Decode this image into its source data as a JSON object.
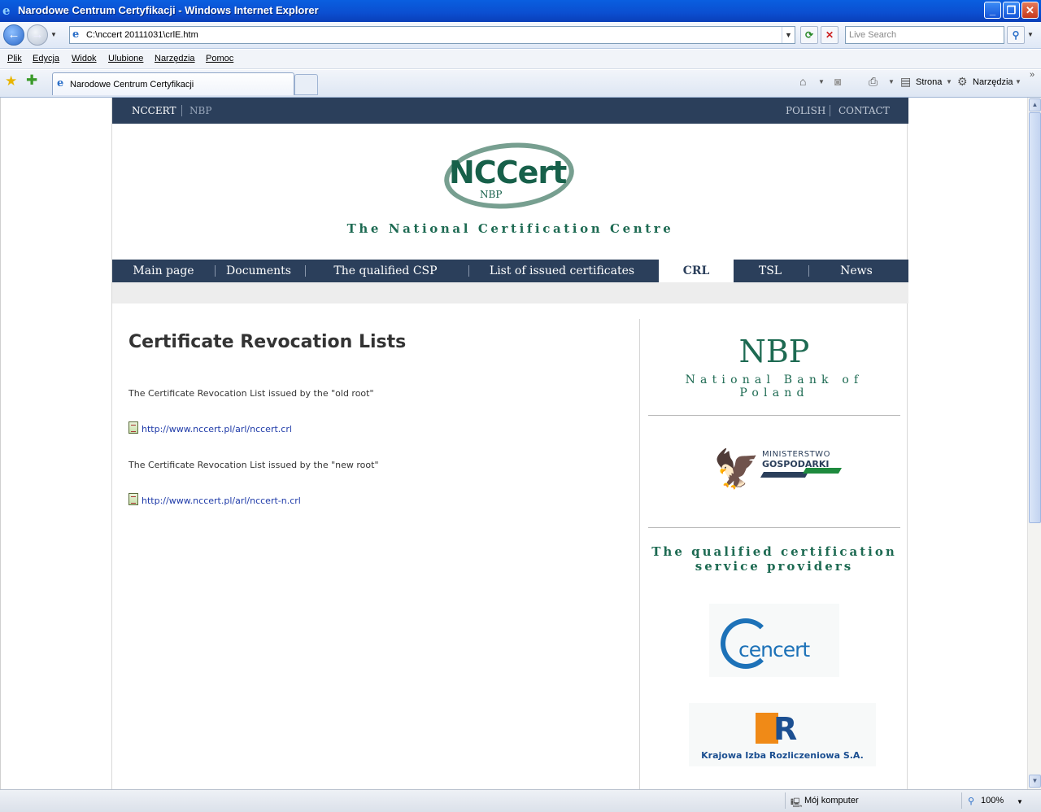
{
  "window": {
    "title": "Narodowe Centrum Certyfikacji - Windows Internet Explorer"
  },
  "address": {
    "url": "C:\\nccert 20111031\\crlE.htm",
    "search_placeholder": "Live Search"
  },
  "menu": [
    "Plik",
    "Edycja",
    "Widok",
    "Ulubione",
    "Narzędzia",
    "Pomoc"
  ],
  "tab": {
    "title": "Narodowe Centrum Certyfikacji"
  },
  "commandbar": {
    "page": "Strona",
    "tools": "Narzędzia"
  },
  "status": {
    "zone": "Mój komputer",
    "zoom": "100%"
  },
  "page": {
    "topstrip": {
      "left": [
        "NCCERT",
        "NBP"
      ],
      "right": [
        "POLISH",
        "CONTACT"
      ]
    },
    "logo": {
      "word": "NCCert",
      "sub": "NBP"
    },
    "tagline": "The National Certification Centre",
    "nav": [
      {
        "label": "Main page",
        "active": false
      },
      {
        "label": "Documents",
        "active": false
      },
      {
        "label": "The qualified CSP",
        "active": false
      },
      {
        "label": "List of issued certificates",
        "active": false
      },
      {
        "label": "CRL",
        "active": true
      },
      {
        "label": "TSL",
        "active": false
      },
      {
        "label": "News",
        "active": false
      }
    ],
    "content": {
      "heading": "Certificate Revocation Lists",
      "items": [
        {
          "text": "The Certificate Revocation List issued by the \"old root\"",
          "link": "http://www.nccert.pl/arl/nccert.crl"
        },
        {
          "text": "The Certificate Revocation List issued by the \"new root\"",
          "link": "http://www.nccert.pl/arl/nccert-n.crl"
        }
      ]
    },
    "sidebar": {
      "nbp_title": "NBP",
      "nbp_sub": "National Bank of Poland",
      "ministry_line1": "MINISTERSTWO",
      "ministry_line2": "GOSPODARKI",
      "qualified_heading": "The qualified certification service providers",
      "cencert": "cencert",
      "kir": "Krajowa Izba Rozliczeniowa S.A."
    }
  },
  "colors": {
    "navy": "#2b3f5b",
    "green": "#1d6a52",
    "link": "#1e3aa8"
  }
}
